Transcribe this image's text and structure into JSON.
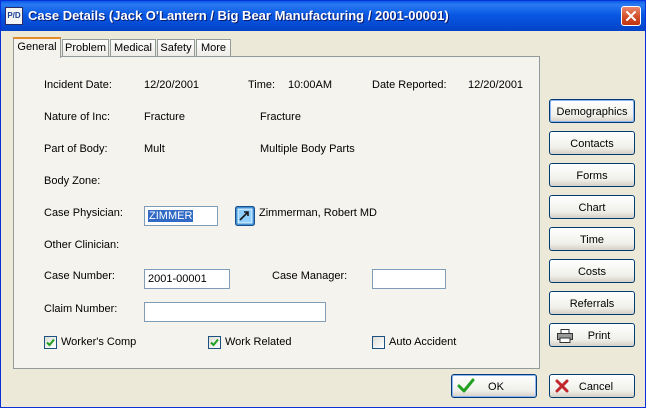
{
  "window": {
    "app_icon_text": "P/D",
    "title": "Case Details (Jack O'Lantern / Big Bear Manufacturing / 2001-00001)"
  },
  "tabs": [
    {
      "label": "General",
      "active": true
    },
    {
      "label": "Problem",
      "active": false
    },
    {
      "label": "Medical",
      "active": false
    },
    {
      "label": "Safety",
      "active": false
    },
    {
      "label": "More",
      "active": false
    }
  ],
  "general": {
    "incident_date_label": "Incident Date:",
    "incident_date_value": "12/20/2001",
    "time_label": "Time:",
    "time_value": "10:00AM",
    "date_reported_label": "Date Reported:",
    "date_reported_value": "12/20/2001",
    "nature_label": "Nature of Inc:",
    "nature_code": "Fracture",
    "nature_desc": "Fracture",
    "part_label": "Part of Body:",
    "part_code": "Mult",
    "part_desc": "Multiple Body Parts",
    "zone_label": "Body Zone:",
    "physician_label": "Case Physician:",
    "physician_value": "ZIMMER",
    "physician_name": "Zimmerman, Robert  MD",
    "other_clinician_label": "Other Clinician:",
    "case_number_label": "Case Number:",
    "case_number_value": "2001-00001",
    "case_manager_label": "Case Manager:",
    "case_manager_value": "",
    "claim_number_label": "Claim Number:",
    "claim_number_value": "",
    "workers_comp_label": "Worker's Comp",
    "workers_comp_checked": true,
    "work_related_label": "Work Related",
    "work_related_checked": true,
    "auto_accident_label": "Auto Accident",
    "auto_accident_checked": false
  },
  "side_buttons": {
    "demographics": "Demographics",
    "contacts": "Contacts",
    "forms": "Forms",
    "chart": "Chart",
    "time": "Time",
    "costs": "Costs",
    "referrals": "Referrals",
    "print": "Print"
  },
  "footer": {
    "ok": "OK",
    "cancel": "Cancel"
  },
  "colors": {
    "titlebar": "#0a5ce6",
    "selection": "#316ac5",
    "tab_highlight": "#e68b2c",
    "checkmark": "#21a121",
    "cancel_x": "#c1272d"
  }
}
